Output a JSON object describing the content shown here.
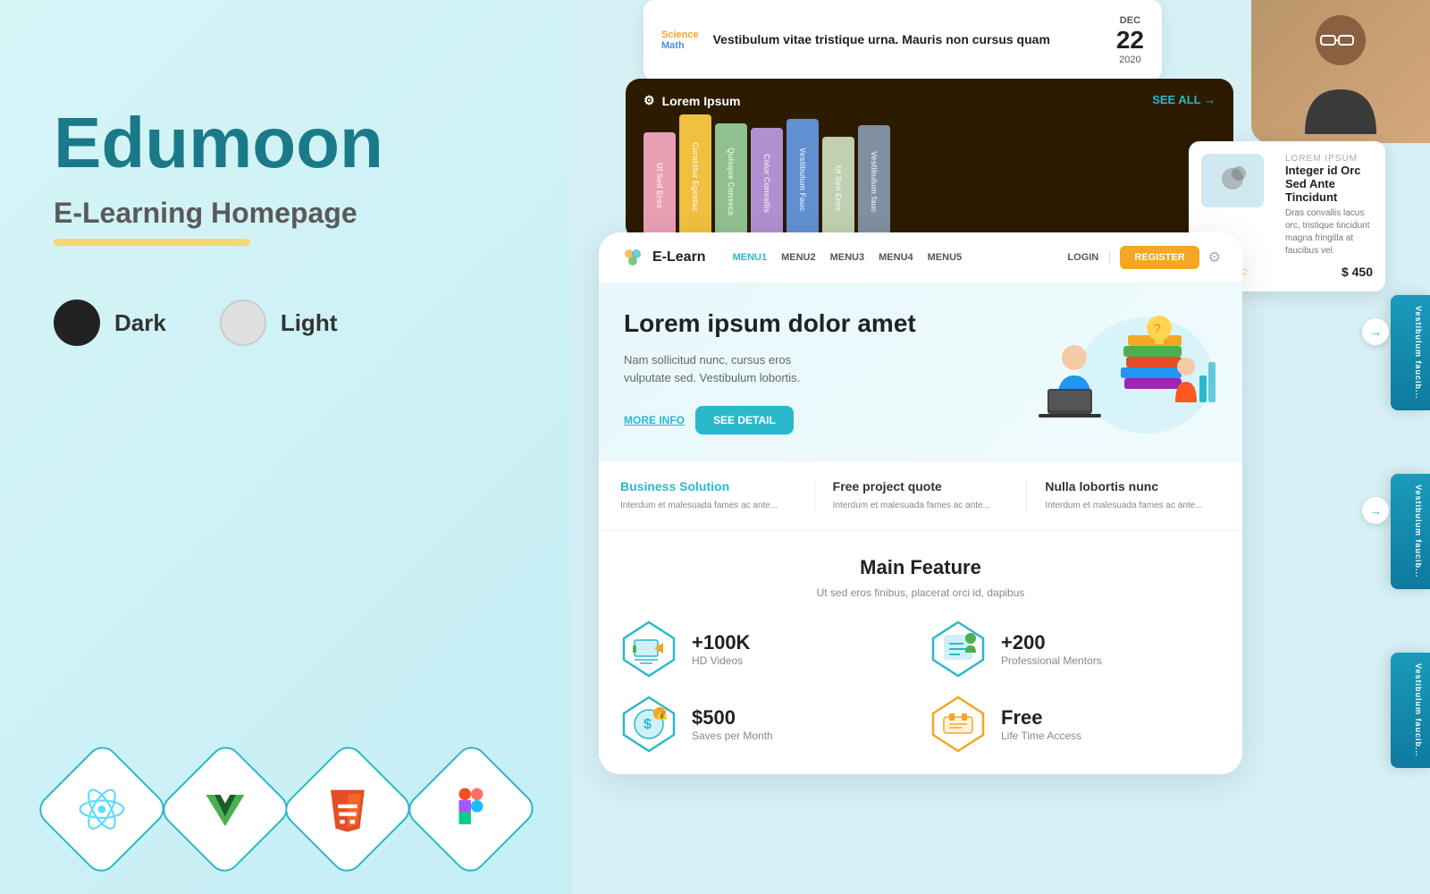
{
  "left": {
    "app_title": "Edumoon",
    "app_subtitle": "E-Learning Homepage",
    "theme_dark_label": "Dark",
    "theme_light_label": "Light",
    "tech_icons": [
      {
        "name": "react",
        "label": "React"
      },
      {
        "name": "vue",
        "label": "Vue"
      },
      {
        "name": "html5",
        "label": "HTML5"
      },
      {
        "name": "figma",
        "label": "Figma"
      }
    ]
  },
  "top_card": {
    "tag1": "Science",
    "tag2": "Math",
    "title": "Vestibulum vitae tristique urna. Mauris non cursus quam",
    "date_month": "DEC",
    "date_day": "22",
    "date_year": "2020"
  },
  "dark_card": {
    "logo_label": "Lorem Ipsum",
    "see_all": "SEE ALL →",
    "books": [
      "Ut Sed Eros",
      "Curabitur Egestas",
      "Quisque Conseca...",
      "Color Convallis",
      "Vestibulum Fauc...",
      "Ut Sed Eros",
      "Vestibulum fauc..."
    ]
  },
  "product_card": {
    "label": "LOREM IPSUM",
    "title": "Integer id Orc Sed Ante Tincidunt",
    "desc": "Dras convallis lacus orc, tristique tincidunt magna fringilla at faucibus vel.",
    "stars": "★★★★☆",
    "price": "$ 450"
  },
  "navbar": {
    "logo_text": "E-Learn",
    "menu_items": [
      "MENU1",
      "MENU2",
      "MENU3",
      "MENU4",
      "MENU5"
    ],
    "login_label": "LOGIN",
    "register_label": "REGISTER"
  },
  "hero": {
    "title": "Lorem ipsum dolor amet",
    "desc_line1": "Nam sollicitud nunc, cursus eros",
    "desc_line2": "vulputate sed. Vestibulum lobortis.",
    "btn_more_info": "MORE INFO",
    "btn_see_detail": "SEE DETAIL"
  },
  "features": [
    {
      "title": "Business Solution",
      "desc": "Interdum et malesuada fames ac ante...",
      "highlighted": true
    },
    {
      "title": "Free project quote",
      "desc": "Interdum et malesuada fames ac ante...",
      "highlighted": false
    },
    {
      "title": "Nulla lobortis nunc",
      "desc": "Interdum et malesuada fames ac ante...",
      "highlighted": false
    }
  ],
  "main_feature": {
    "title": "Main Feature",
    "subtitle": "Ut sed eros finibus, placerat orci id, dapibus",
    "stats": [
      {
        "number": "+100K",
        "label": "HD Videos",
        "icon": "🖥️"
      },
      {
        "number": "+200",
        "label": "Professional Mentors",
        "icon": "📚"
      },
      {
        "number": "$500",
        "label": "Saves per Month",
        "icon": "💰"
      },
      {
        "number": "Free",
        "label": "Life Time Access",
        "icon": "🎟️"
      }
    ]
  },
  "sidebar_cards": [
    {
      "text": "Vestibulum faucib..."
    },
    {
      "text": "Vestibulum faucib..."
    },
    {
      "text": "Vestibulum faucib..."
    }
  ]
}
